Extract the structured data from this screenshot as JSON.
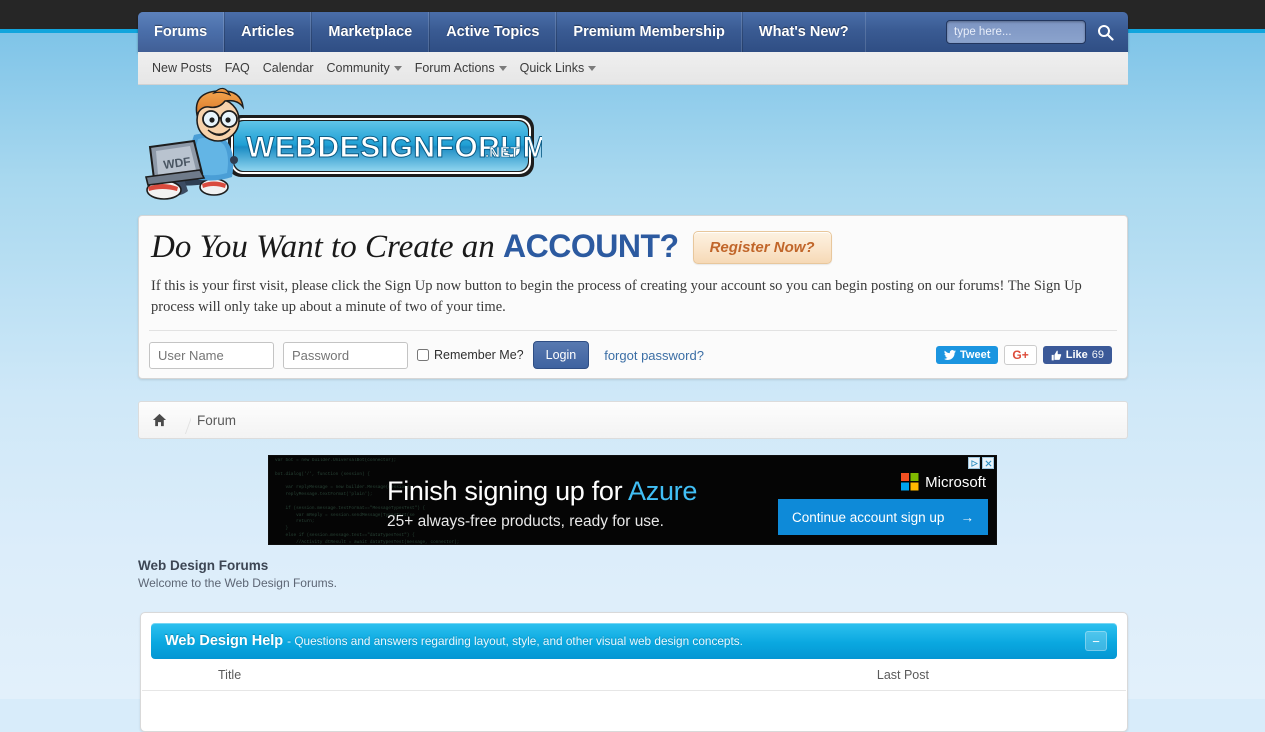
{
  "nav": {
    "tabs": [
      {
        "label": "Forums",
        "active": true
      },
      {
        "label": "Articles",
        "active": false
      },
      {
        "label": "Marketplace",
        "active": false
      },
      {
        "label": "Active Topics",
        "active": false
      },
      {
        "label": "Premium Membership",
        "active": false
      },
      {
        "label": "What's New?",
        "active": false
      }
    ],
    "search_placeholder": "type here...",
    "search_value": "",
    "search_icon": "search-icon"
  },
  "subnav": {
    "items": [
      {
        "label": "New Posts",
        "caret": false
      },
      {
        "label": "FAQ",
        "caret": false
      },
      {
        "label": "Calendar",
        "caret": false
      },
      {
        "label": "Community",
        "caret": true
      },
      {
        "label": "Forum Actions",
        "caret": true
      },
      {
        "label": "Quick Links",
        "caret": true
      }
    ]
  },
  "logo": {
    "text_main": "WEBDESIGNFORUMS",
    "text_suffix": ".NET",
    "laptop_label": "WDF"
  },
  "account": {
    "title_italic": "Do You Want to Create an ",
    "title_strong": "ACCOUNT?",
    "register_label": "Register Now?",
    "description": "If this is your first visit, please click the Sign Up now button to begin the process of creating your account so you can begin posting on our forums! The Sign Up process will only take up about a minute of two of your time.",
    "username_placeholder": "User Name",
    "username_value": "",
    "password_placeholder": "Password",
    "password_value": "",
    "remember_label": "Remember Me?",
    "remember_checked": false,
    "login_label": "Login",
    "forgot_label": "forgot password?",
    "social": {
      "tweet_label": "Tweet",
      "gplus_label": "G+",
      "like_label": "Like",
      "like_count": "69"
    }
  },
  "breadcrumb": {
    "home_icon": "home-icon",
    "current": "Forum"
  },
  "ad": {
    "headline_prefix": "Finish signing up for ",
    "headline_brand": "Azure",
    "subtext": "25+ always-free products, ready for use.",
    "brand_label": "Microsoft",
    "cta_label": "Continue account sign up",
    "cta_arrow": "→",
    "adchoices_icon": "adchoices-icon",
    "close_icon": "close-icon",
    "code_snippet": "var bot = new builder.UniversalBot(connector);\n\nbot.dialog('/', function (session) {\n\n    var replyMessage = new builder.Message(session);\n    replyMessage.textFormat('plain');\n\n    if (session.message.textFormat==\"MessageTypesTest\") {\n        var mReply = session.sendMessage(TypesTest(se\n        return;\n    }\n    else if (session.message.text==\"dataTypesTest\") {\n        //Activity dtResult = await dataTypesTest(message, connector);"
  },
  "forums": {
    "heading": "Web Design Forums",
    "subheading": "Welcome to the Web Design Forums.",
    "category": {
      "title": "Web Design Help",
      "description": "- Questions and answers regarding layout, style, and other visual web design concepts.",
      "collapse_label": "−",
      "columns": {
        "title": "Title",
        "last_post": "Last Post"
      }
    }
  },
  "colors": {
    "nav_blue": "#3a5b93",
    "accent_cyan": "#12a5dd",
    "account_blue": "#2c5aa0",
    "register_orange": "#c1662a",
    "ad_blue": "#0e8ad8"
  }
}
